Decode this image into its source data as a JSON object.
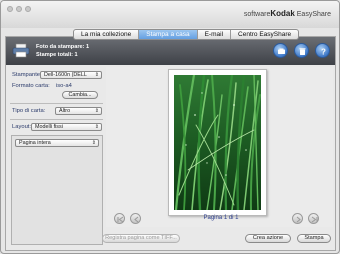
{
  "brand": {
    "prefix": "software",
    "name": "Kodak",
    "suffix": " EasyShare"
  },
  "tabs": [
    {
      "label": "La mia collezione",
      "active": false
    },
    {
      "label": "Stampa a casa",
      "active": true
    },
    {
      "label": "E-mail",
      "active": false
    },
    {
      "label": "Centro EasyShare",
      "active": false
    }
  ],
  "info": {
    "photos_line": "Foto da stampare: 1",
    "totals_line": "Stampe totali: 1"
  },
  "left": {
    "printer_label": "Stampante:",
    "printer_value": "Dell-1600n (DELL",
    "paper_format_label": "Formato carta:",
    "paper_format_value": "iso-a4",
    "change_button": "Cambia...",
    "paper_type_label": "Tipo di carta:",
    "paper_type_value": "Altro",
    "layout_label": "Layout:",
    "layout_value": "Modelli fissi",
    "layout_option": "Pagina intera"
  },
  "preview": {
    "page_label": "Pagina 1 di 1"
  },
  "bottom": {
    "save_tiff": "Registra pagina come TIFF...",
    "create_action": "Crea azione",
    "print": "Stampa"
  },
  "colors": {
    "active_tab": "#5f9be0",
    "info_bar": "#4a4d53",
    "accent_text": "#2d3f8e"
  },
  "icons": [
    "printer-icon",
    "rotate-icon",
    "trash-icon",
    "help-icon",
    "first-page-icon",
    "prev-page-icon",
    "next-page-icon",
    "last-page-icon"
  ]
}
